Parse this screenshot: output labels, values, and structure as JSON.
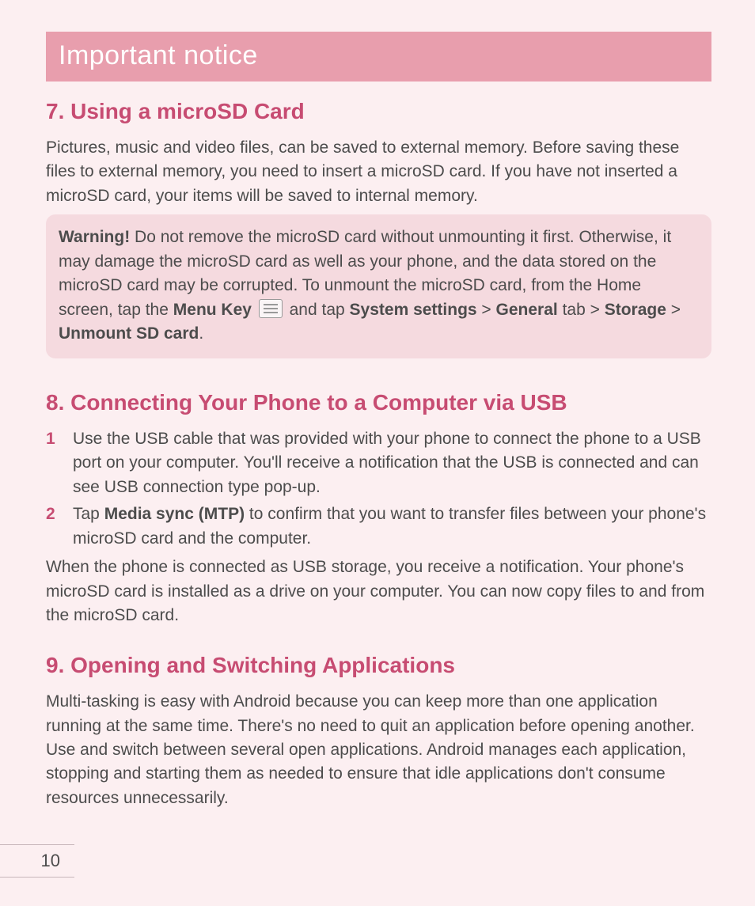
{
  "banner": {
    "title": "Important notice"
  },
  "section7": {
    "heading": "7. Using a microSD Card",
    "para1": "Pictures, music and video files, can be saved to external memory. Before saving these files to external memory, you need to insert a microSD card. If you have not inserted a microSD card, your items will be saved to internal memory.",
    "warning": {
      "label": "Warning!",
      "text_before_menu": " Do not remove the microSD card without unmounting it first. Otherwise, it may damage the microSD card as well as your phone, and the data stored on the microSD card may be corrupted. To unmount the microSD card, from the Home screen, tap the ",
      "menu_key_label": "Menu Key",
      "text_between_1": " and tap ",
      "system_settings_label": "System settings",
      "text_between_2": " > ",
      "general_label": "General",
      "text_between_3": " tab > ",
      "storage_label": "Storage",
      "text_between_4": " > ",
      "unmount_label": "Unmount SD card",
      "text_end": "."
    }
  },
  "section8": {
    "heading": "8. Connecting Your Phone to a Computer via USB",
    "steps": [
      {
        "num": "1",
        "text": "Use the USB cable that was provided with your phone to connect the phone to a USB port on your computer. You'll receive a notification that the USB is connected and can see USB connection type pop-up."
      },
      {
        "num": "2",
        "pre": "Tap ",
        "bold": "Media sync (MTP)",
        "post": " to confirm that you want to transfer files between your phone's microSD card and the computer."
      }
    ],
    "para_after": "When the phone is connected as USB storage, you receive a notification. Your phone's microSD card is installed as a drive on your computer. You can now copy files to and from the microSD card."
  },
  "section9": {
    "heading": "9. Opening and Switching Applications",
    "para1": "Multi-tasking is easy with Android because you can keep more than one application running at the same time. There's no need to quit an application before opening another. Use and switch between several open applications. Android manages each application, stopping and starting them as needed to ensure that idle applications don't consume resources unnecessarily."
  },
  "footer": {
    "page_number": "10"
  }
}
